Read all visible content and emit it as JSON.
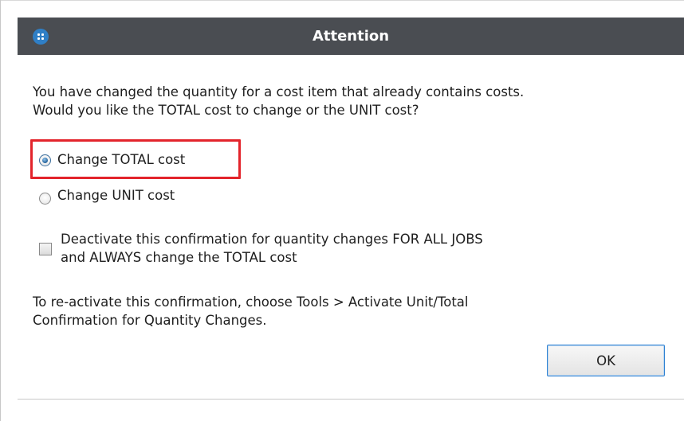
{
  "dialog": {
    "title": "Attention",
    "app_icon": "app-icon",
    "message_line1": "You have changed the quantity for a cost item that already contains costs.",
    "message_line2": "Would you like the TOTAL cost to change or the UNIT cost?",
    "options": [
      {
        "label": "Change TOTAL cost",
        "checked": true,
        "highlighted": true
      },
      {
        "label": "Change UNIT cost",
        "checked": false
      }
    ],
    "checkbox": {
      "label_line1": "Deactivate this confirmation for quantity changes FOR ALL JOBS",
      "label_line2": "and ALWAYS change the TOTAL cost",
      "checked": false
    },
    "info_line1": "To re-activate this confirmation, choose Tools > Activate Unit/Total",
    "info_line2": "Confirmation for Quantity Changes.",
    "ok_label": "OK"
  },
  "colors": {
    "titlebar": "#4a4d52",
    "highlight": "#e3242b",
    "button_border": "#2f82d3"
  }
}
